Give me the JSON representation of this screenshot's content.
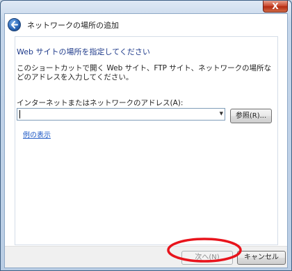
{
  "window": {
    "title": "ネットワークの場所の追加",
    "close_label": "X"
  },
  "page": {
    "heading": "Web サイトの場所を指定してください",
    "description": "このショートカットで開く Web サイト、FTP サイト、ネットワークの場所などのアドレスを入力してください。",
    "address_label": "インターネットまたはネットワークのアドレス(A):",
    "address_value": "",
    "browse_label": "参照(R)...",
    "example_link": "例の表示"
  },
  "footer": {
    "next_label": "次へ(N)",
    "cancel_label": "キャンセル"
  },
  "annotation": {
    "color": "#e8141c",
    "shape": "ellipse",
    "target": "next-button"
  },
  "icons": {
    "back": "back-arrow-icon",
    "combo": "dropdown-arrow-icon"
  }
}
